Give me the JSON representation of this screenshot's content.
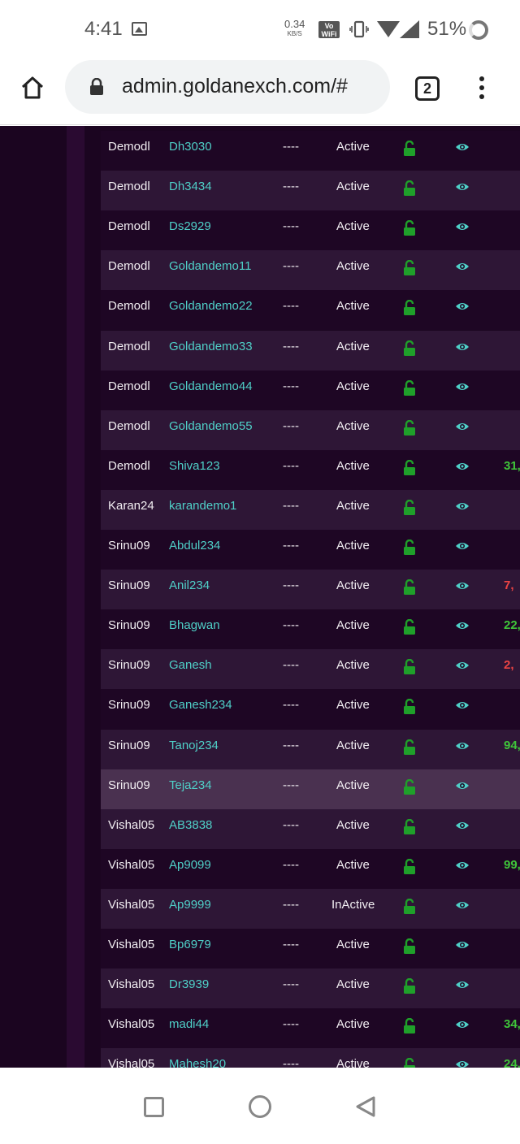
{
  "status_bar": {
    "time": "4:41",
    "net_speed": "0.34",
    "net_unit": "KB/S",
    "vowifi_top": "Vo",
    "vowifi_bottom": "WiFi",
    "battery": "51%"
  },
  "browser": {
    "url": "admin.goldanexch.com/#",
    "tab_count": "2"
  },
  "colors": {
    "background": "#1b0520",
    "username": "#4fd0c8",
    "lock": "#1fa02a",
    "eye": "#4fd0c8",
    "positive": "#3fc53a",
    "negative": "#ee4444"
  },
  "rows": [
    {
      "parent": "Demodl",
      "username": "Dh3030",
      "dash": "----",
      "status": "Active",
      "balance": "",
      "tone": ""
    },
    {
      "parent": "Demodl",
      "username": "Dh3434",
      "dash": "----",
      "status": "Active",
      "balance": "",
      "tone": ""
    },
    {
      "parent": "Demodl",
      "username": "Ds2929",
      "dash": "----",
      "status": "Active",
      "balance": "",
      "tone": ""
    },
    {
      "parent": "Demodl",
      "username": "Goldandemo11",
      "dash": "----",
      "status": "Active",
      "balance": "",
      "tone": ""
    },
    {
      "parent": "Demodl",
      "username": "Goldandemo22",
      "dash": "----",
      "status": "Active",
      "balance": "",
      "tone": ""
    },
    {
      "parent": "Demodl",
      "username": "Goldandemo33",
      "dash": "----",
      "status": "Active",
      "balance": "",
      "tone": ""
    },
    {
      "parent": "Demodl",
      "username": "Goldandemo44",
      "dash": "----",
      "status": "Active",
      "balance": "",
      "tone": ""
    },
    {
      "parent": "Demodl",
      "username": "Goldandemo55",
      "dash": "----",
      "status": "Active",
      "balance": "",
      "tone": ""
    },
    {
      "parent": "Demodl",
      "username": "Shiva123",
      "dash": "----",
      "status": "Active",
      "balance": "31,",
      "tone": "pos"
    },
    {
      "parent": "Karan24",
      "username": "karandemo1",
      "dash": "----",
      "status": "Active",
      "balance": "",
      "tone": ""
    },
    {
      "parent": "Srinu09",
      "username": "Abdul234",
      "dash": "----",
      "status": "Active",
      "balance": "",
      "tone": ""
    },
    {
      "parent": "Srinu09",
      "username": "Anil234",
      "dash": "----",
      "status": "Active",
      "balance": "7,",
      "tone": "neg"
    },
    {
      "parent": "Srinu09",
      "username": "Bhagwan",
      "dash": "----",
      "status": "Active",
      "balance": "22,",
      "tone": "pos"
    },
    {
      "parent": "Srinu09",
      "username": "Ganesh",
      "dash": "----",
      "status": "Active",
      "balance": "2,",
      "tone": "neg"
    },
    {
      "parent": "Srinu09",
      "username": "Ganesh234",
      "dash": "----",
      "status": "Active",
      "balance": "",
      "tone": ""
    },
    {
      "parent": "Srinu09",
      "username": "Tanoj234",
      "dash": "----",
      "status": "Active",
      "balance": "94,",
      "tone": "pos"
    },
    {
      "parent": "Srinu09",
      "username": "Teja234",
      "dash": "----",
      "status": "Active",
      "balance": "",
      "tone": "",
      "highlight": true
    },
    {
      "parent": "Vishal05",
      "username": "AB3838",
      "dash": "----",
      "status": "Active",
      "balance": "",
      "tone": ""
    },
    {
      "parent": "Vishal05",
      "username": "Ap9099",
      "dash": "----",
      "status": "Active",
      "balance": "99,",
      "tone": "pos"
    },
    {
      "parent": "Vishal05",
      "username": "Ap9999",
      "dash": "----",
      "status": "InActive",
      "balance": "",
      "tone": ""
    },
    {
      "parent": "Vishal05",
      "username": "Bp6979",
      "dash": "----",
      "status": "Active",
      "balance": "",
      "tone": ""
    },
    {
      "parent": "Vishal05",
      "username": "Dr3939",
      "dash": "----",
      "status": "Active",
      "balance": "",
      "tone": ""
    },
    {
      "parent": "Vishal05",
      "username": "madi44",
      "dash": "----",
      "status": "Active",
      "balance": "34,",
      "tone": "pos"
    },
    {
      "parent": "Vishal05",
      "username": "Mahesh20",
      "dash": "----",
      "status": "Active",
      "balance": "24,",
      "tone": "pos"
    }
  ]
}
